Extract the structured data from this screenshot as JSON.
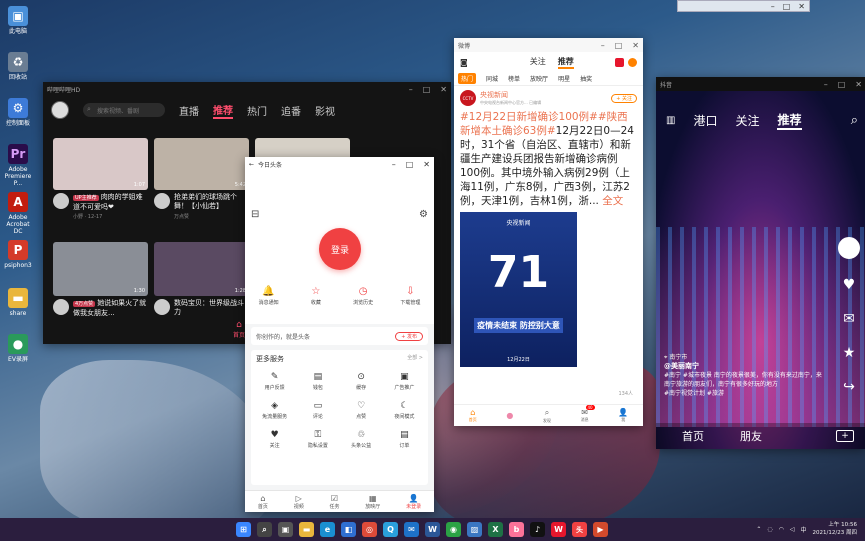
{
  "desktop": {
    "icons": [
      {
        "label": "此电脑",
        "icon": "computer-icon",
        "color": "#4a90d9",
        "glyph": "▣"
      },
      {
        "label": "回收站",
        "icon": "recycle-bin-icon",
        "color": "#6a7d93",
        "glyph": "♻"
      },
      {
        "label": "控制面板",
        "icon": "control-panel-icon",
        "color": "#3d7bd8",
        "glyph": "⚙"
      },
      {
        "label": "Adobe Premiere P...",
        "icon": "premiere-icon",
        "color": "#2a0c4a",
        "glyph": "Pr"
      },
      {
        "label": "Adobe Acrobat DC",
        "icon": "acrobat-icon",
        "color": "#c21d0f",
        "glyph": "A"
      },
      {
        "label": "psiphon3",
        "icon": "psiphon-icon",
        "color": "#d43b2a",
        "glyph": "P"
      },
      {
        "label": "share",
        "icon": "folder-icon",
        "color": "#e9b63c",
        "glyph": "▬"
      },
      {
        "label": "EV录屏",
        "icon": "ev-recorder-icon",
        "color": "#2a9a5b",
        "glyph": "●"
      }
    ]
  },
  "video_app": {
    "title": "哔哩哔哩HD",
    "search_placeholder": "搜索视频、番剧",
    "tabs": [
      "直播",
      "推荐",
      "热门",
      "追番",
      "影视"
    ],
    "active_tab": "推荐",
    "cards": [
      {
        "title": "肉肉的学姐难道不可爱吗❤",
        "badge": "UP主推荐",
        "meta": "小野 · 12-17",
        "duration": "1:07",
        "color": "#d9c8c8"
      },
      {
        "title": "抢弟弟们的球场跳个舞！【小仙若】",
        "badge": "",
        "meta": "万点赞",
        "duration": "5:42",
        "color": "#bdb2a6"
      },
      {
        "title": "",
        "badge": "",
        "meta": "",
        "duration": "",
        "color": "#d6d0c6"
      },
      {
        "title": "她说如果火了就做我女朋友...",
        "badge": "4万点赞",
        "meta": "",
        "duration": "1:30",
        "color": "#8a8e96"
      },
      {
        "title": "数码宝贝：世界级战斗力",
        "badge": "",
        "meta": "",
        "duration": "1:28",
        "color": "#5a4a62"
      }
    ],
    "home_label": "首页"
  },
  "toutiao": {
    "title": "今日头条",
    "login_label": "登录",
    "quick": [
      {
        "label": "消息通知",
        "glyph": "🔔"
      },
      {
        "label": "收藏",
        "glyph": "☆"
      },
      {
        "label": "浏览历史",
        "glyph": "◷"
      },
      {
        "label": "下载管理",
        "glyph": "⇩"
      }
    ],
    "creation_text": "你创作的，就是头条",
    "publish_label": "+ 发布",
    "services_title": "更多服务",
    "services_all": "全部 >",
    "services": [
      {
        "label": "用户反馈",
        "glyph": "✎"
      },
      {
        "label": "钱包",
        "glyph": "▤"
      },
      {
        "label": "缓存",
        "glyph": "⊙"
      },
      {
        "label": "广告推广",
        "glyph": "▣"
      },
      {
        "label": "免流量服务",
        "glyph": "◈"
      },
      {
        "label": "评论",
        "glyph": "▭"
      },
      {
        "label": "点赞",
        "glyph": "♡"
      },
      {
        "label": "夜间模式",
        "glyph": "☾"
      },
      {
        "label": "关注",
        "glyph": "♥"
      },
      {
        "label": "隐私设置",
        "glyph": "⚿"
      },
      {
        "label": "头条公益",
        "glyph": "♲"
      },
      {
        "label": "订单",
        "glyph": "▤"
      }
    ],
    "bottom": [
      {
        "label": "首页",
        "glyph": "⌂"
      },
      {
        "label": "视频",
        "glyph": "▷"
      },
      {
        "label": "任务",
        "glyph": "☑"
      },
      {
        "label": "放映厅",
        "glyph": "▦"
      },
      {
        "label": "未登录",
        "glyph": "👤"
      }
    ],
    "active_bottom": "未登录"
  },
  "weibo": {
    "title": "微博",
    "tabs": [
      "关注",
      "推荐"
    ],
    "active_tab": "推荐",
    "categories": [
      "热门",
      "同城",
      "榜单",
      "放映厅",
      "明星",
      "抽奖"
    ],
    "active_category": "热门",
    "author": "央视新闻",
    "author_sub": "中央电视台新闻中心官方... 已编辑",
    "follow_label": "+ 关注",
    "post_tag": "#12月22日新增确诊100例#",
    "post_tag2": "#陕西新增本土确诊63例#",
    "post_body": "12月22日0—24时，31个省（自治区、直辖市）和新疆生产建设兵团报告新增确诊病例100例。其中境外输入病例29例（上海11例，广东8例，广西3例，江苏2例，天津1例，吉林1例，浙...",
    "more_label": "全文",
    "image_logo": "央视新闻",
    "image_number": "71",
    "image_slogan": "疫情未结束 防控别大意",
    "image_date": "12月22日",
    "like_count": "134人",
    "bottom": [
      {
        "label": "首页",
        "glyph": "⌂"
      },
      {
        "label": "",
        "glyph": "●"
      },
      {
        "label": "发现",
        "glyph": "⌕"
      },
      {
        "label": "消息",
        "glyph": "✉",
        "badge": "40"
      },
      {
        "label": "我",
        "glyph": "👤"
      }
    ]
  },
  "douyin": {
    "title": "抖音",
    "nav": [
      "港口",
      "关注",
      "推荐"
    ],
    "active_nav": "推荐",
    "location": "南宁市",
    "author": "@美丽南宁",
    "caption": "#南宁 #城市夜景 南宁的夜景很美，你有没有来过南宁，来南宁旅游的朋友们，南宁有很多好玩的地方",
    "tag": "#南宁视觉计划 #旅游",
    "bottom": [
      "首页",
      "朋友"
    ]
  },
  "taskbar": {
    "time": "上午 10:56",
    "date": "2021/12/23 周四",
    "lang": "中",
    "apps": [
      {
        "name": "windows-start-icon",
        "color": "#3a86ff",
        "glyph": "⊞"
      },
      {
        "name": "search-icon",
        "color": "#444",
        "glyph": "⌕"
      },
      {
        "name": "task-view-icon",
        "color": "#555",
        "glyph": "▣"
      },
      {
        "name": "file-explorer-icon",
        "color": "#e9b63c",
        "glyph": "▬"
      },
      {
        "name": "edge-icon",
        "color": "#1a8fd1",
        "glyph": "e"
      },
      {
        "name": "store-icon",
        "color": "#2f6fd1",
        "glyph": "◧"
      },
      {
        "name": "chrome-icon",
        "color": "#dd4b39",
        "glyph": "◎"
      },
      {
        "name": "qq-icon",
        "color": "#2a9fdb",
        "glyph": "Q"
      },
      {
        "name": "mail-icon",
        "color": "#1e72c8",
        "glyph": "✉"
      },
      {
        "name": "word-icon",
        "color": "#2b5797",
        "glyph": "W"
      },
      {
        "name": "wechat-icon",
        "color": "#2ba245",
        "glyph": "◉"
      },
      {
        "name": "photos-icon",
        "color": "#3a76c2",
        "glyph": "▨"
      },
      {
        "name": "excel-icon",
        "color": "#1e7145",
        "glyph": "X"
      },
      {
        "name": "bilibili-icon",
        "color": "#fb7299",
        "glyph": "b"
      },
      {
        "name": "tiktok-icon",
        "color": "#111",
        "glyph": "♪"
      },
      {
        "name": "weibo-icon",
        "color": "#e6162d",
        "glyph": "W"
      },
      {
        "name": "toutiao-icon",
        "color": "#f04142",
        "glyph": "头"
      },
      {
        "name": "media-icon",
        "color": "#d34a2c",
        "glyph": "▶"
      }
    ]
  }
}
